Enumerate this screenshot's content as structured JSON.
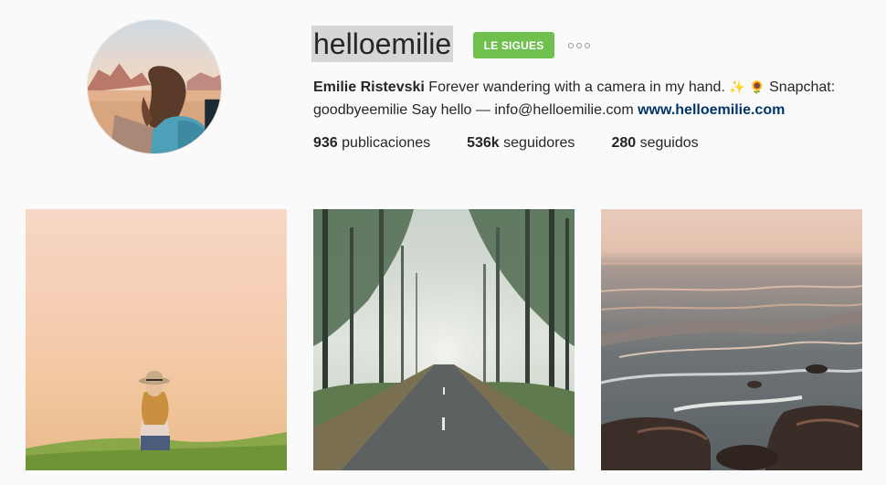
{
  "profile": {
    "username": "helloemilie",
    "follow_label": "LE SIGUES",
    "more_icon": "ellipsis-icon",
    "bio": {
      "name": "Emilie Ristevski",
      "text": "Forever wandering with a camera in my hand.",
      "emoji_sparkles": "✨",
      "emoji_sunflower": "🌻",
      "text2": "Snapchat: goodbyeemilie Say hello — info@helloemilie.com",
      "link": "www.helloemilie.com"
    },
    "stats": {
      "posts_count": "936",
      "posts_label": "publicaciones",
      "followers_count": "536k",
      "followers_label": "seguidores",
      "following_count": "280",
      "following_label": "seguidos"
    }
  },
  "colors": {
    "follow_button": "#70c050",
    "link": "#003569",
    "background": "#fafafa"
  }
}
